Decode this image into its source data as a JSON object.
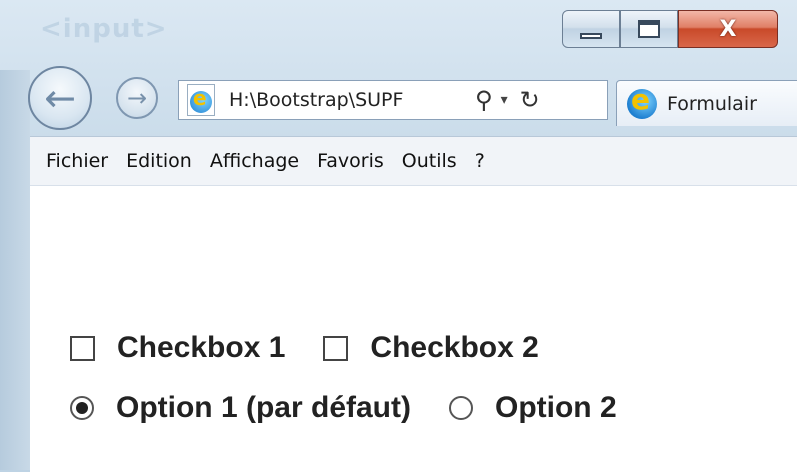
{
  "window": {
    "background_text": "<input>",
    "minimize_symbol": "",
    "close_symbol": "X"
  },
  "nav": {
    "back_symbol": "←",
    "forward_symbol": "→",
    "address": "H:\\Bootstrap\\SUPF",
    "search_symbol": "⚲",
    "dropdown_symbol": "▾",
    "refresh_symbol": "↻"
  },
  "tab": {
    "label": "Formulair"
  },
  "menu": {
    "items": [
      "Fichier",
      "Edition",
      "Affichage",
      "Favoris",
      "Outils",
      "?"
    ]
  },
  "form": {
    "checkboxes": [
      {
        "label": "Checkbox 1",
        "checked": false
      },
      {
        "label": "Checkbox 2",
        "checked": false
      }
    ],
    "radios": [
      {
        "label": "Option 1 (par défaut)",
        "selected": true
      },
      {
        "label": "Option 2",
        "selected": false
      }
    ]
  },
  "colors": {
    "accent": "#1e7fd0",
    "close_button": "#c94a2a"
  }
}
